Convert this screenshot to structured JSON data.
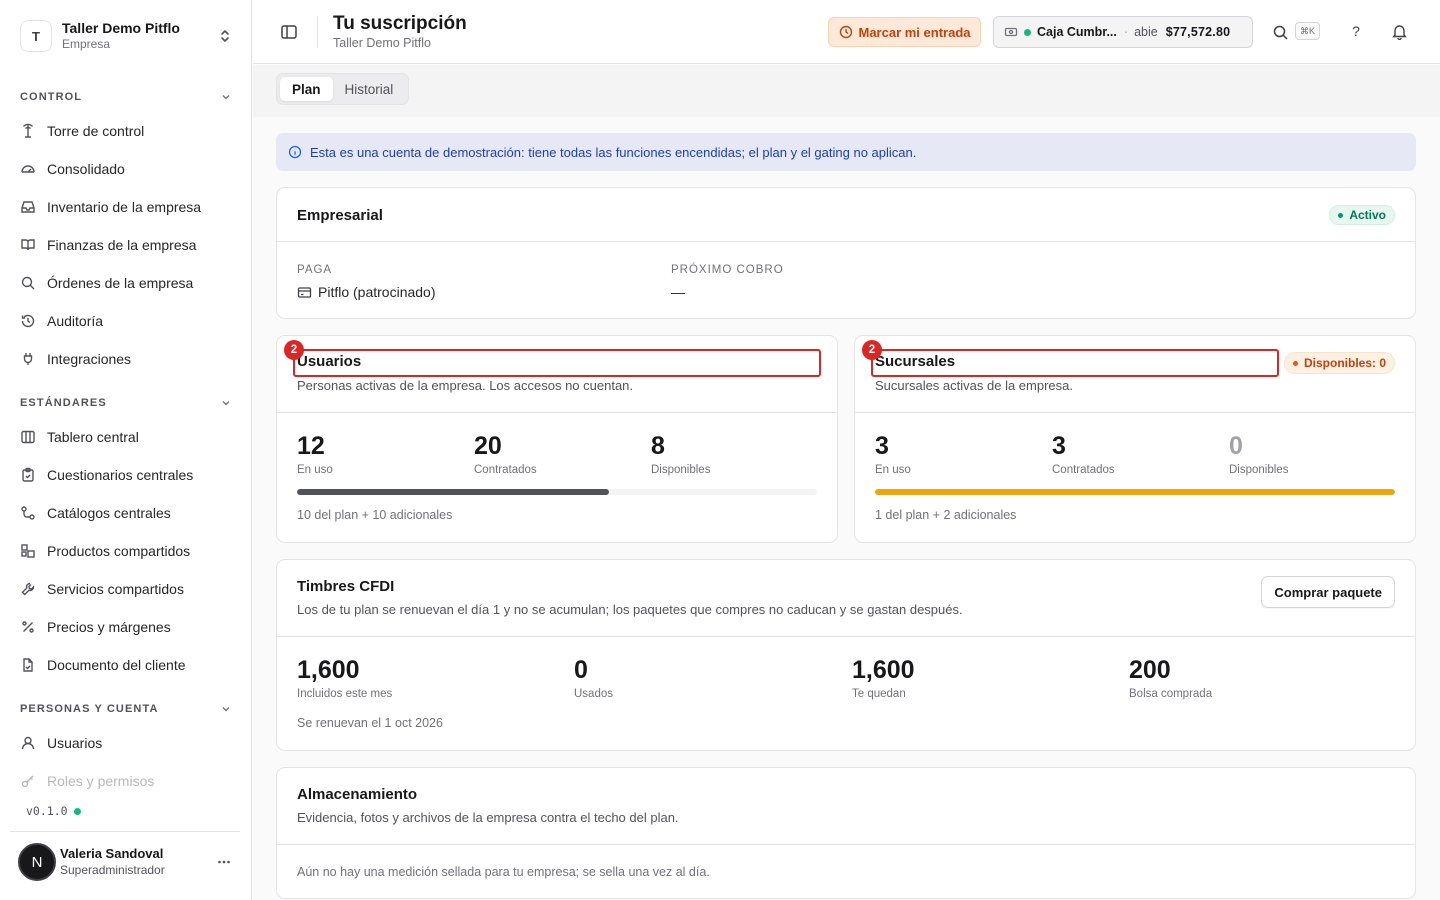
{
  "org": {
    "initial": "T",
    "name": "Taller Demo Pitflo",
    "type": "Empresa"
  },
  "nav": {
    "sections": [
      {
        "title": "CONTROL",
        "items": [
          {
            "label": "Torre de control",
            "icon": "tower-icon"
          },
          {
            "label": "Consolidado",
            "icon": "gauge-icon"
          },
          {
            "label": "Inventario de la empresa",
            "icon": "inbox-icon"
          },
          {
            "label": "Finanzas de la empresa",
            "icon": "book-open-icon"
          },
          {
            "label": "Órdenes de la empresa",
            "icon": "search-icon"
          },
          {
            "label": "Auditoría",
            "icon": "history-icon"
          },
          {
            "label": "Integraciones",
            "icon": "plug-icon"
          }
        ]
      },
      {
        "title": "ESTÁNDARES",
        "items": [
          {
            "label": "Tablero central",
            "icon": "columns-icon"
          },
          {
            "label": "Cuestionarios centrales",
            "icon": "clipboard-icon"
          },
          {
            "label": "Catálogos centrales",
            "icon": "route-icon"
          },
          {
            "label": "Productos compartidos",
            "icon": "boxes-icon"
          },
          {
            "label": "Servicios compartidos",
            "icon": "wrench-icon"
          },
          {
            "label": "Precios y márgenes",
            "icon": "percent-icon"
          },
          {
            "label": "Documento del cliente",
            "icon": "file-check-icon"
          }
        ]
      },
      {
        "title": "PERSONAS Y CUENTA",
        "items": [
          {
            "label": "Usuarios",
            "icon": "user-icon"
          },
          {
            "label": "Roles y permisos",
            "icon": "key-icon"
          }
        ]
      }
    ]
  },
  "version": "v0.1.0",
  "user": {
    "initial": "N",
    "name": "Valeria Sandoval",
    "role": "Superadministrador"
  },
  "header": {
    "title": "Tu suscripción",
    "subtitle": "Taller Demo Pitflo",
    "checkin_label": "Marcar mi entrada",
    "cash": {
      "name": "Caja Cumbr...",
      "separator": "·",
      "state": "abie",
      "amount": "$77,572.80"
    },
    "shortcut": "⌘K",
    "help": "?"
  },
  "tabs": [
    {
      "label": "Plan",
      "active": true
    },
    {
      "label": "Historial",
      "active": false
    }
  ],
  "banner": "Esta es una cuenta de demostración: tiene todas las funciones encendidas; el plan y el gating no aplican.",
  "plan": {
    "name": "Empresarial",
    "status": "Activo",
    "payer_label": "PAGA",
    "payer_value": "Pitflo (patrocinado)",
    "next_label": "PRÓXIMO COBRO",
    "next_value": "—"
  },
  "users": {
    "marker": "2",
    "title": "Usuarios",
    "desc": "Personas activas de la empresa. Los accesos no cuentan.",
    "in_use": "12",
    "in_use_label": "En uso",
    "contracted": "20",
    "contracted_label": "Contratados",
    "available": "8",
    "available_label": "Disponibles",
    "progress": 0.6,
    "bar_color": "#52525b",
    "foot": "10 del plan + 10 adicionales"
  },
  "branches": {
    "marker": "2",
    "title": "Sucursales",
    "desc": "Sucursales activas de la empresa.",
    "badge": "Disponibles: 0",
    "in_use": "3",
    "in_use_label": "En uso",
    "contracted": "3",
    "contracted_label": "Contratados",
    "available": "0",
    "available_label": "Disponibles",
    "progress": 1.0,
    "bar_color": "#eaa50f",
    "foot": "1 del plan + 2 adicionales"
  },
  "stamps": {
    "title": "Timbres CFDI",
    "desc": "Los de tu plan se renuevan el día 1 y no se acumulan; los paquetes que compres no caducan y se gastan después.",
    "buy_label": "Comprar paquete",
    "stats": [
      {
        "value": "1,600",
        "label": "Incluidos este mes"
      },
      {
        "value": "0",
        "label": "Usados"
      },
      {
        "value": "1,600",
        "label": "Te quedan"
      },
      {
        "value": "200",
        "label": "Bolsa comprada"
      }
    ],
    "foot": "Se renuevan el 1 oct 2026"
  },
  "storage": {
    "title": "Almacenamiento",
    "desc": "Evidencia, fotos y archivos de la empresa contra el techo del plan.",
    "note": "Aún no hay una medición sellada para tu empresa; se sella una vez al día."
  }
}
